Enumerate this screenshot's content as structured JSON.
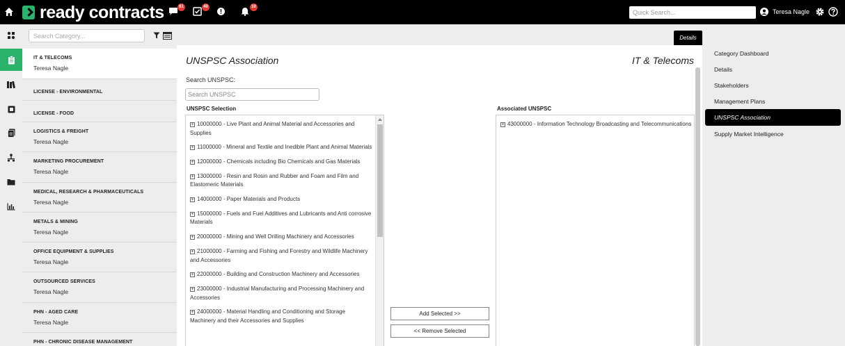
{
  "header": {
    "app_name": "ready contracts",
    "badges": {
      "messages": "61",
      "tasks": "40",
      "notifications": "10"
    },
    "quick_search_placeholder": "Quick Search...",
    "user_name": "Teresa Nagle"
  },
  "category_search": {
    "placeholder": "Search Category..."
  },
  "categories": [
    {
      "name": "IT & TELECOMS",
      "owner": "Teresa Nagle"
    },
    {
      "name": "LICENSE - ENVIRONMENTAL",
      "owner": ""
    },
    {
      "name": "LICENSE - FOOD",
      "owner": ""
    },
    {
      "name": "LOGISTICS & FREIGHT",
      "owner": "Teresa Nagle"
    },
    {
      "name": "MARKETING PROCUREMENT",
      "owner": "Teresa Nagle"
    },
    {
      "name": "MEDICAL, RESEARCH & PHARMACEUTICALS",
      "owner": "Teresa Nagle"
    },
    {
      "name": "METALS & MINING",
      "owner": "Teresa Nagle"
    },
    {
      "name": "OFFICE EQUIPMENT & SUPPLIES",
      "owner": "Teresa Nagle"
    },
    {
      "name": "OUTSOURCED SERVICES",
      "owner": "Teresa Nagle"
    },
    {
      "name": "PHN - AGED CARE",
      "owner": "Teresa Nagle"
    },
    {
      "name": "PHN - CHRONIC DISEASE MANAGEMENT",
      "owner": ""
    }
  ],
  "details_tab": "Details",
  "main": {
    "title": "UNSPSC Association",
    "subtitle": "IT & Telecoms",
    "search_label": "Search UNSPSC:",
    "search_placeholder": "Search UNSPSC",
    "selection_label": "UNSPSC Selection",
    "associated_label": "Associated UNSPSC",
    "selection_items": [
      "10000000 - Live Plant and Animal Material and Accessories and Supplies",
      "11000000 - Mineral and Textile and Inedible Plant and Animal Materials",
      "12000000 - Chemicals including Bio Chemicals and Gas Materials",
      "13000000 - Resin and Rosin and Rubber and Foam and Film and Elastomeric Materials",
      "14000000 - Paper Materials and Products",
      "15000000 - Fuels and Fuel Additives and Lubricants and Anti corrosive Materials",
      "20000000 - Mining and Well Drilling Machinery and Accessories",
      "21000000 - Farming and Fishing and Forestry and Wildlife Machinery and Accessories",
      "22000000 - Building and Construction Machinery and Accessories",
      "23000000 - Industrial Manufacturing and Processing Machinery and Accessories",
      "24000000 - Material Handling and Conditioning and Storage Machinery and their Accessories and Supplies"
    ],
    "associated_items": [
      "43000000 - Information Technology Broadcasting and Telecommunications"
    ],
    "add_button": "Add Selected >>",
    "remove_button": "<< Remove Selected"
  },
  "right_nav": [
    {
      "label": "Category Dashboard",
      "active": false
    },
    {
      "label": "Details",
      "active": false
    },
    {
      "label": "Stakeholders",
      "active": false
    },
    {
      "label": "Management Plans",
      "active": false
    },
    {
      "label": "UNSPSC Association",
      "active": true
    },
    {
      "label": "Supply Market Intelligence",
      "active": false
    }
  ],
  "colors": {
    "accent": "#2bb36b",
    "badge": "#e53935",
    "topbar": "#000000"
  }
}
